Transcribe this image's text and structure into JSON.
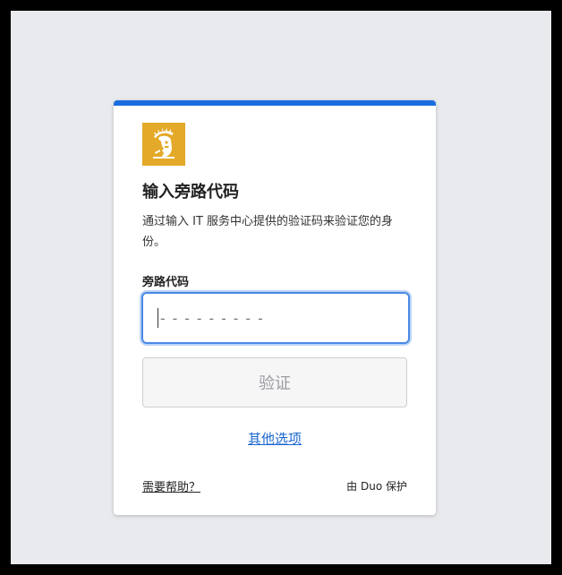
{
  "page": {
    "title": "输入旁路代码",
    "description": "通过输入 IT 服务中心提供的验证码来验证您的身份。"
  },
  "form": {
    "label": "旁路代码",
    "input_value": "",
    "placeholder": "---------",
    "verify_label": "验证"
  },
  "links": {
    "other_options": "其他选项",
    "help": "需要帮助？"
  },
  "footer": {
    "secured_by": "由 Duo 保护"
  },
  "colors": {
    "accent": "#1a6ee0",
    "logo_bg": "#e4a928",
    "link": "#1a66d0",
    "background": "#e9eaee"
  },
  "icons": {
    "logo": "spartan-helmet-icon"
  }
}
